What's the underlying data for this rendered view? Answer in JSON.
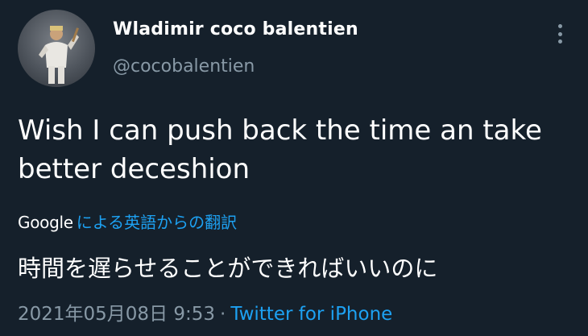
{
  "user": {
    "display_name": "Wladimir coco balentien",
    "handle": "@cocobalentien"
  },
  "tweet": {
    "text": "Wish I can push back the time an take better deceshion"
  },
  "translation": {
    "provider": "Google",
    "link_text": "による英語からの翻訳",
    "translated_text": "時間を遅らせることができればいいのに"
  },
  "meta": {
    "timestamp": "2021年05月08日 9:53",
    "separator": "·",
    "source": "Twitter for iPhone"
  },
  "icons": {
    "more": "more-vertical-icon"
  },
  "colors": {
    "background": "#15202b",
    "accent": "#1da1f2",
    "secondary_text": "#8899a6"
  }
}
